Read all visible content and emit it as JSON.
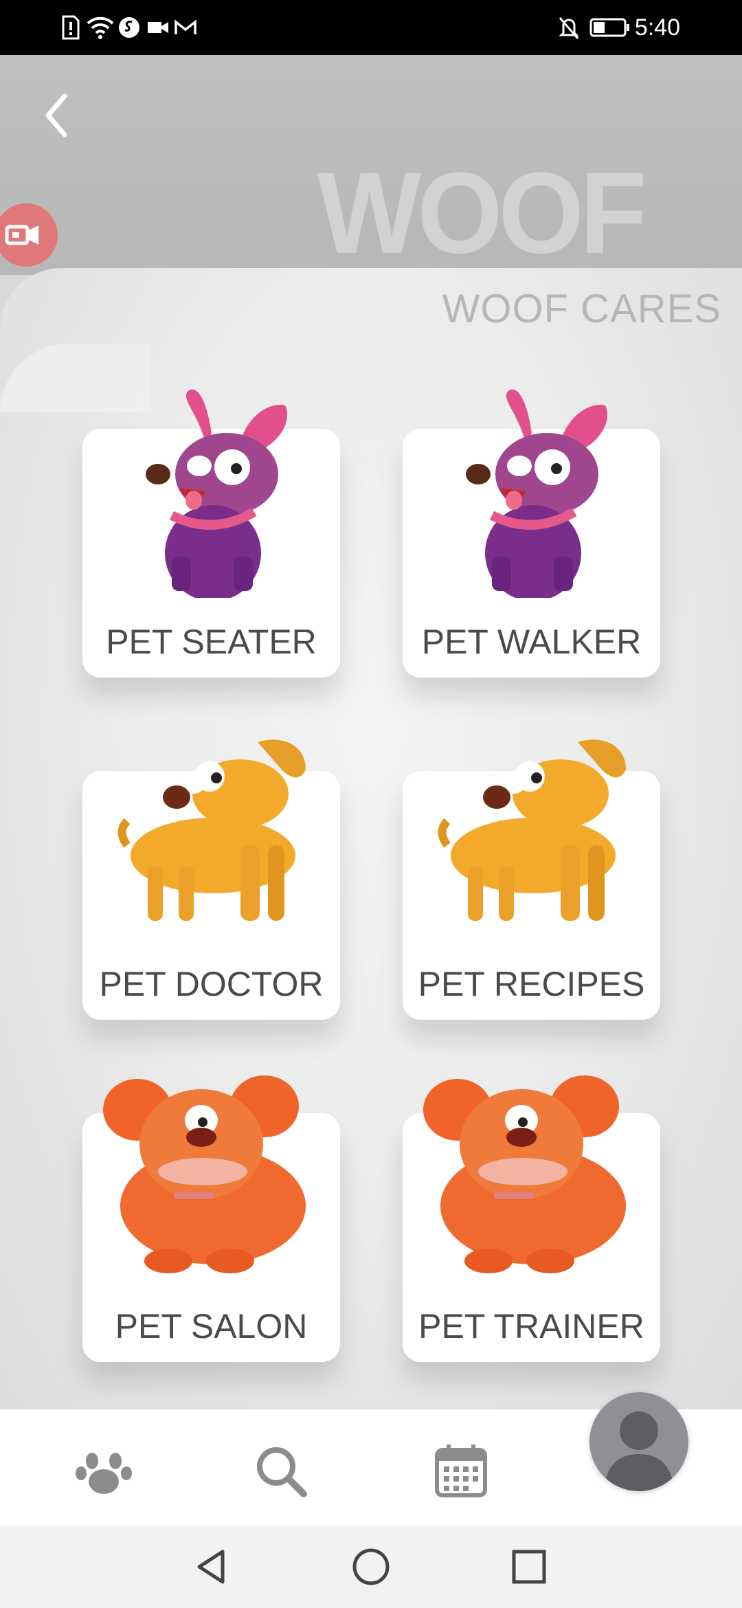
{
  "status_bar": {
    "time": "5:40",
    "left_icons": [
      "sim-alert-icon",
      "wifi-icon",
      "shazam-icon",
      "video-icon",
      "gmail-icon"
    ],
    "right_icons": [
      "mute-icon",
      "battery-icon"
    ]
  },
  "header": {
    "brand_watermark": "WOOF",
    "title": "WOOF CARES"
  },
  "cards": [
    {
      "label": "PET SEATER",
      "icon": "purple-dog"
    },
    {
      "label": "PET WALKER",
      "icon": "purple-dog"
    },
    {
      "label": "PET DOCTOR",
      "icon": "yellow-dog"
    },
    {
      "label": "PET RECIPES",
      "icon": "yellow-dog"
    },
    {
      "label": "PET SALON",
      "icon": "orange-bulldog"
    },
    {
      "label": "PET TRAINER",
      "icon": "orange-bulldog"
    }
  ],
  "bottom_nav": [
    "paw-icon",
    "search-icon",
    "calendar-icon",
    "profile-avatar"
  ],
  "system_nav": [
    "back-icon",
    "home-icon",
    "recents-icon"
  ],
  "colors": {
    "card_text": "#4a4a4a",
    "record_button": "#e0787a",
    "nav_icon": "#8c8c8c",
    "purple_dog": "#8a3a9a",
    "yellow_dog": "#f3aa2a",
    "orange_dog": "#f0642a"
  }
}
